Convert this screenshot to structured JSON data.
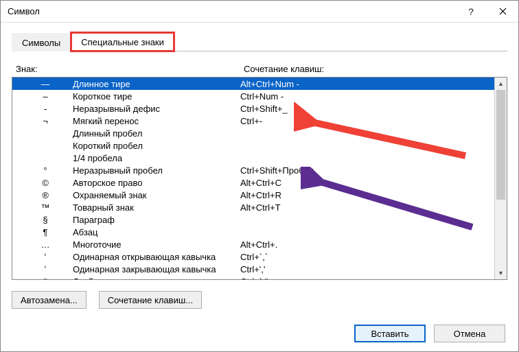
{
  "window": {
    "title": "Символ"
  },
  "tabs": {
    "symbols": "Символы",
    "special": "Специальные знаки"
  },
  "headers": {
    "char": "Знак:",
    "shortcut": "Сочетание клавиш:"
  },
  "rows": [
    {
      "sym": "—",
      "name": "Длинное тире",
      "sc": "Alt+Ctrl+Num -",
      "selected": true
    },
    {
      "sym": "–",
      "name": "Короткое тире",
      "sc": "Ctrl+Num -"
    },
    {
      "sym": "-",
      "name": "Неразрывный дефис",
      "sc": "Ctrl+Shift+_"
    },
    {
      "sym": "¬",
      "name": "Мягкий перенос",
      "sc": "Ctrl+-"
    },
    {
      "sym": "",
      "name": "Длинный пробел",
      "sc": ""
    },
    {
      "sym": "",
      "name": "Короткий пробел",
      "sc": ""
    },
    {
      "sym": "",
      "name": "1/4 пробела",
      "sc": ""
    },
    {
      "sym": "°",
      "name": "Неразрывный пробел",
      "sc": "Ctrl+Shift+Пробел"
    },
    {
      "sym": "©",
      "name": "Авторское право",
      "sc": "Alt+Ctrl+C"
    },
    {
      "sym": "®",
      "name": "Охраняемый знак",
      "sc": "Alt+Ctrl+R"
    },
    {
      "sym": "™",
      "name": "Товарный знак",
      "sc": "Alt+Ctrl+T"
    },
    {
      "sym": "§",
      "name": "Параграф",
      "sc": ""
    },
    {
      "sym": "¶",
      "name": "Абзац",
      "sc": ""
    },
    {
      "sym": "…",
      "name": "Многоточие",
      "sc": "Alt+Ctrl+."
    },
    {
      "sym": "ʻ",
      "name": "Одинарная открывающая кавычка",
      "sc": "Ctrl+`,`"
    },
    {
      "sym": "ʼ",
      "name": "Одинарная закрывающая кавычка",
      "sc": "Ctrl+','"
    },
    {
      "sym": "\"",
      "name": "Двойная открывающая кавычка",
      "sc": "Ctrl+`,\""
    }
  ],
  "buttons": {
    "autocorrect": "Автозамена...",
    "shortcut": "Сочетание клавиш...",
    "insert": "Вставить",
    "cancel": "Отмена"
  }
}
